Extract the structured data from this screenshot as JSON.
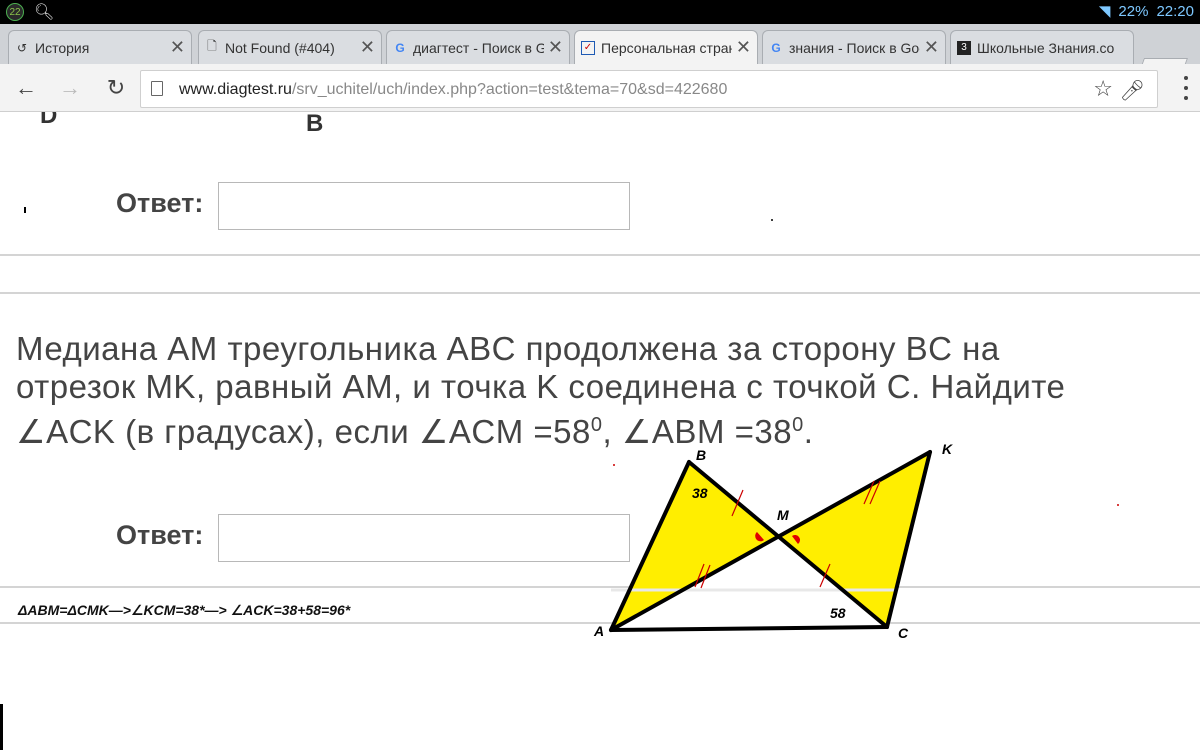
{
  "status_bar": {
    "badge": "22",
    "battery": "22%",
    "time": "22:20"
  },
  "tabs": [
    {
      "label": "История",
      "icon": "history-icon",
      "active": false
    },
    {
      "label": "Not Found (#404)",
      "icon": "page-icon",
      "active": false
    },
    {
      "label": "диагтест - Поиск в Goo",
      "icon": "google-icon",
      "active": false
    },
    {
      "label": "Персональная страни",
      "icon": "checkbox-icon",
      "active": true
    },
    {
      "label": "знания - Поиск в Goo",
      "icon": "google-icon",
      "active": false
    },
    {
      "label": "Школьные Знания.co",
      "icon": "znanija-icon",
      "active": false
    }
  ],
  "omnibox": {
    "host": "www.diagtest.ru",
    "path": "/srv_uchitel/uch/index.php?action=test&tema=70&sd=422680"
  },
  "page": {
    "top_fragment_left": "D",
    "top_fragment_right": "B",
    "answer_label": "Ответ:",
    "question_lines": [
      "Медиана AM треугольника ABC продолжена за сторону BC на",
      "отрезок MK, равный AM, и точка K соединена с точкой C. Найдите"
    ],
    "question_line3": {
      "a": "∠ACK (в градусах), если ∠ACM =58",
      "sup1": "0",
      "b": ", ∠ABM =38",
      "sup2": "0",
      "c": "."
    },
    "solution": "ΔABM=ΔCMK—>∠KCM=38*—>  ∠ACK=38+58=96*"
  },
  "figure": {
    "vertex_labels": {
      "A": "A",
      "B": "B",
      "C": "C",
      "K": "K",
      "M": "M"
    },
    "angle_labels": {
      "at_B": "38",
      "at_C": "58"
    },
    "fill_color": "#ffee00"
  }
}
